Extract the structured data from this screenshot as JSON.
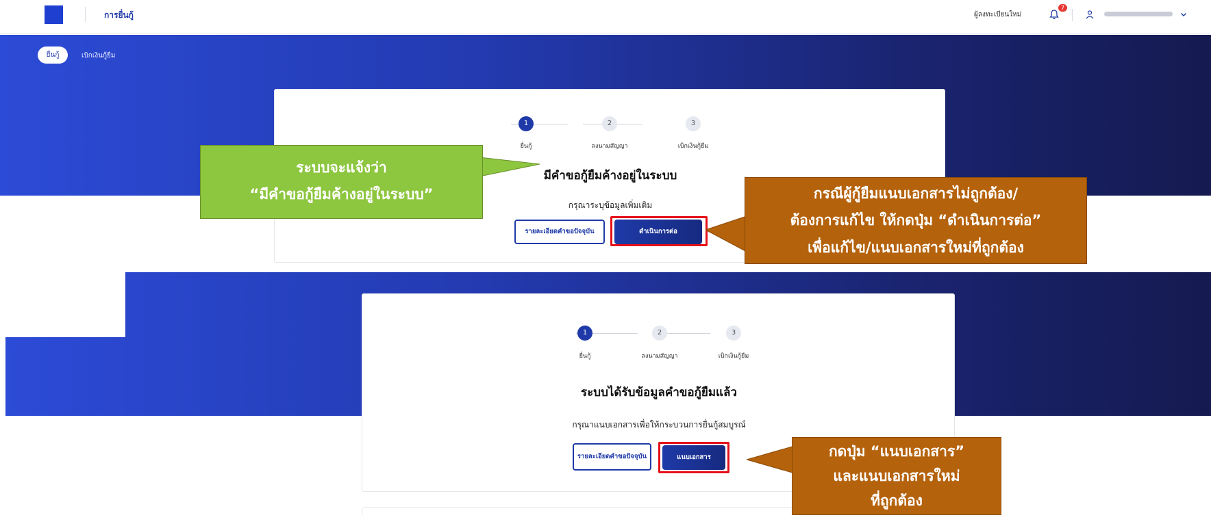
{
  "nav": {
    "title": "การยื่นกู้",
    "register_link": "ผู้ลงทะเบียนใหม่",
    "notification_count": "7"
  },
  "tabs": {
    "active": "ยื่นกู้",
    "other": "เบิกเงินกู้ยืม"
  },
  "stepper": [
    {
      "number": "1",
      "label": "ยื่นกู้"
    },
    {
      "number": "2",
      "label": "ลงนามสัญญา"
    },
    {
      "number": "3",
      "label": "เบิกเงินกู้ยืม"
    }
  ],
  "card1": {
    "title": "มีคำขอกู้ยืมค้างอยู่ในระบบ",
    "subtitle": "กรุณาระบุข้อมูลเพิ่มเติม",
    "details_button": "รายละเอียดคำขอปัจจุบัน",
    "continue_button": "ดำเนินการต่อ"
  },
  "card2": {
    "title": "ระบบได้รับข้อมูลคำขอกู้ยืมแล้ว",
    "subtitle": "กรุณาแนบเอกสารเพื่อให้กระบวนการยื่นกู้สมบูรณ์",
    "details_button": "รายละเอียดคำขอปัจจุบัน",
    "attach_button": "แนบเอกสาร"
  },
  "callouts": {
    "green": [
      "ระบบจะแจ้งว่า",
      "“มีคำขอกู้ยืมค้างอยู่ในระบบ”"
    ],
    "orange_top": [
      "กรณีผู้กู้ยืมแนบเอกสารไม่ถูกต้อง/",
      "ต้องการแก้ไข ให้กดปุ่ม “ดำเนินการต่อ”",
      "เพื่อแก้ไข/แนบเอกสารใหม่ที่ถูกต้อง"
    ],
    "orange_bottom": [
      "กดปุ่ม “แนบเอกสาร”",
      "และแนบเอกสารใหม่",
      "ที่ถูกต้อง"
    ]
  },
  "colors": {
    "primary": "#1f3aa8",
    "highlight": "#e5101a",
    "green_callout": "#8dc63f",
    "orange_callout": "#b5620c"
  }
}
